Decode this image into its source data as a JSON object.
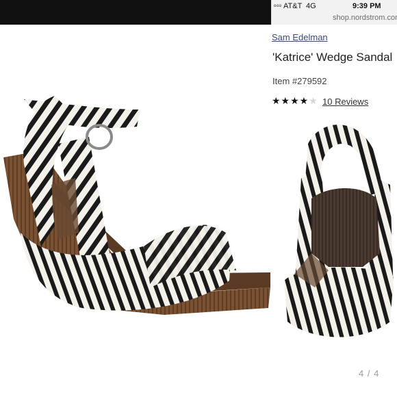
{
  "status_bar": {
    "signal": "ooo",
    "carrier": "AT&T",
    "network": "4G",
    "time": "9:39 PM",
    "url": "shop.nordstrom.com"
  },
  "product": {
    "brand": "Sam Edelman",
    "title": "'Katrice' Wedge Sandal",
    "item_number": "Item #279592",
    "rating_value": 4,
    "rating_max": 5,
    "stars_full": "★★★★",
    "stars_empty": "★",
    "reviews_link": "10 Reviews"
  },
  "images": {
    "side_view": "zebra-print-wedge-sandal-side",
    "back_view": "zebra-print-wedge-sandal-back"
  },
  "pagination": "4 / 4",
  "colors": {
    "brand_link": "#3b4a6b",
    "wedge": "#6e4a2e",
    "zebra_dark": "#1a1a1a",
    "zebra_light": "#f4f1ea"
  }
}
